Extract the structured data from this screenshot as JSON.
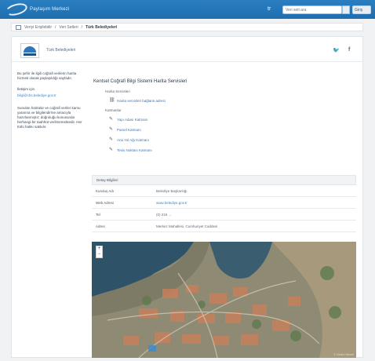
{
  "header": {
    "brand_text": "Paylaşım Merkezi",
    "lang": "tr",
    "search_placeholder": "Veri seti ara",
    "user_button": "Giriş"
  },
  "breadcrumb": {
    "items": [
      "Veriyi Erişilebilir",
      "Veri Setleri"
    ],
    "current": "Türk Belediyeleri"
  },
  "organization": {
    "name": "Türk Belediyeleri"
  },
  "sidebar": {
    "intro": "Bu şehir ile ilgili coğrafi verilerin harita hizmeti olarak paylaşıldığı sayfadır.",
    "contact_heading": "İletişim için",
    "contact_link": "bilgi@cbs.belediye.gov.tr",
    "description": "Sunulan haritalar ve coğrafi veriler kamu yararına ve bilgilendirme amacıyla hazırlanmıştır; doğruluğu konusunda herhangi bir taahhüt verilmemektedir. Her türlü hakkı saklıdır."
  },
  "main": {
    "title": "Kentsel Coğrafi Bilgi Sistemi Harita Servisleri",
    "section_services": "Harita Servisleri",
    "service_link": "Harita servisleri bağlantı adresi",
    "section_layers": "Katmanlar",
    "layers": [
      "Yapı Adası Katmanı",
      "Parsel Katmanı",
      "Ana Yol Ağı Katmanı",
      "Tesis Noktası Katmanı"
    ]
  },
  "table": {
    "header": "Detay Bilgileri",
    "rows": [
      {
        "key": "Kuruluş Adı",
        "value": "Belediye Başkanlığı"
      },
      {
        "key": "Web Adresi",
        "value": "www.belediye.gov.tr",
        "link": true
      },
      {
        "key": "Tel",
        "value": "(0) 216 ..."
      },
      {
        "key": "Adres",
        "value": "Merkez Mahallesi, Cumhuriyet Caddesi"
      }
    ]
  },
  "map": {
    "zoom_in": "+",
    "zoom_out": "−",
    "attribution": "© Harita Hizmeti"
  },
  "icons": {
    "twitter": "twitter-icon",
    "facebook": "facebook-icon",
    "layer": "layer-icon",
    "link": "link-icon"
  },
  "colors": {
    "topbar": "#2a7fc1",
    "link": "#3f86c8"
  }
}
